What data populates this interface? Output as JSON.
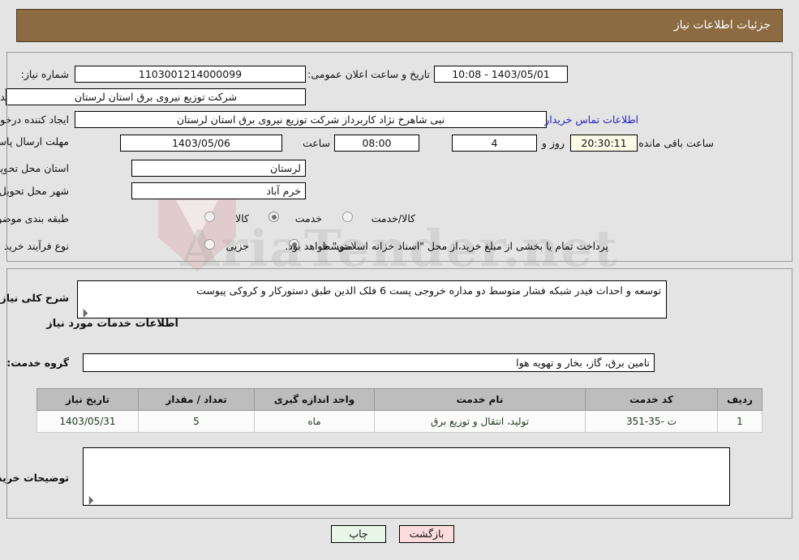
{
  "header": {
    "title": "جزئیات اطلاعات نیاز"
  },
  "top_form": {
    "need_number_label": "شماره نیاز:",
    "need_number_value": "1103001214000099",
    "announce_label": "تاریخ و ساعت اعلان عمومی:",
    "announce_value": "1403/05/01 - 10:08",
    "buyer_org_label": "نام دستگاه خریدار:",
    "buyer_org_value": "شرکت توزیع نیروی برق استان لرستان",
    "creator_label": "ایجاد کننده درخواست:",
    "creator_value": "نبی شاهرخ نژاد کاربرداز شرکت توزیع نیروی برق استان لرستان",
    "contact_link": "اطلاعات تماس خریدار",
    "deadline_label": "مهلت ارسال پاسخ: تا تاریخ:",
    "deadline_date": "1403/05/06",
    "hour_label": "ساعت",
    "hour_value": "08:00",
    "days_value": "4",
    "days_label": "روز و",
    "timer_value": "20:30:11",
    "remaining_label": "ساعت باقی مانده",
    "province_label": "استان محل تحویل:",
    "province_value": "لرستان",
    "city_label": "شهر محل تحویل:",
    "city_value": "خرم آباد",
    "category_label": "طبقه بندی موضوعی:",
    "category_options": [
      {
        "label": "کالا",
        "selected": false
      },
      {
        "label": "خدمت",
        "selected": true
      },
      {
        "label": "کالا/خدمت",
        "selected": false
      }
    ],
    "process_label": "نوع فرآیند خرید :",
    "process_options": [
      {
        "label": "جزیی",
        "selected": false
      },
      {
        "label": "متوسط",
        "selected": true
      }
    ],
    "process_note": "پرداخت تمام یا بخشی از مبلغ خرید،از محل \"اسناد خزانه اسلامی\" خواهد بود."
  },
  "detail": {
    "summary_label": "شرح کلی نیاز:",
    "summary_value": "توسعه  و احداث  فیدر شبکه فشار متوسط دو مداره خروجی پست 6 فلک الدین طبق دستورکار  و کروکی پیوست",
    "services_heading": "اطلاعات خدمات مورد نیاز",
    "service_group_label": "گروه خدمت:",
    "service_group_value": "تامین برق، گاز، بخار و تهویه هوا",
    "table": {
      "columns": [
        "ردیف",
        "کد خدمت",
        "نام خدمت",
        "واحد اندازه گیری",
        "تعداد / مقدار",
        "تاریخ نیاز"
      ],
      "rows": [
        {
          "row": "1",
          "code": "ت -35-351",
          "name": "تولید، انتقال و توزیع برق",
          "unit": "ماه",
          "qty": "5",
          "date": "1403/05/31"
        }
      ]
    },
    "buyer_notes_label": "توضیحات خریدار:",
    "buyer_notes_value": ""
  },
  "footer": {
    "print_label": "چاپ",
    "back_label": "بازگشت"
  },
  "watermark": {
    "text": "AriaTender.net"
  },
  "colors": {
    "header_band": "#8c6a42",
    "page_bg": "#e4e4e4",
    "link": "#2222cc",
    "table_header": "#bdbdbd",
    "print_btn": "#e8f6e8",
    "back_btn": "#fcdcdc",
    "timer_bg": "#fbfbe8"
  }
}
